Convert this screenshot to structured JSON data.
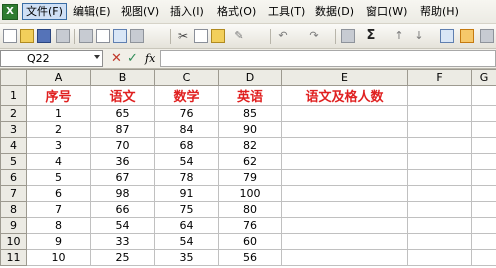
{
  "menu": {
    "items": [
      {
        "label": "文件(F)",
        "active": true
      },
      {
        "label": "编辑(E)"
      },
      {
        "label": "视图(V)"
      },
      {
        "label": "插入(I)"
      },
      {
        "label": "格式(O)"
      },
      {
        "label": "工具(T)"
      },
      {
        "label": "数据(D)"
      },
      {
        "label": "窗口(W)"
      },
      {
        "label": "帮助(H)"
      }
    ]
  },
  "toolbar": {
    "sigma": "Σ",
    "icons": [
      "new-doc-icon",
      "open-folder-icon",
      "save-icon",
      "permission-icon",
      "print-icon",
      "print-preview-icon",
      "spell-check-icon",
      "research-icon",
      "cut-icon",
      "copy-icon",
      "paste-icon",
      "format-painter-icon",
      "undo-icon",
      "redo-icon",
      "hyperlink-icon",
      "autosum-icon",
      "sort-ascending-icon",
      "sort-descending-icon",
      "chart-wizard-icon",
      "drawing-icon"
    ]
  },
  "formula_bar": {
    "name_box": "Q22",
    "fx": "fx",
    "content": ""
  },
  "sheet": {
    "columns": [
      "A",
      "B",
      "C",
      "D",
      "E",
      "F",
      "G"
    ],
    "rows": [
      {
        "num": "1",
        "cells": [
          "序号",
          "语文",
          "数学",
          "英语",
          "语文及格人数",
          "",
          ""
        ],
        "header": true
      },
      {
        "num": "2",
        "cells": [
          "1",
          "65",
          "76",
          "85",
          "",
          "",
          ""
        ]
      },
      {
        "num": "3",
        "cells": [
          "2",
          "87",
          "84",
          "90",
          "",
          "",
          ""
        ]
      },
      {
        "num": "4",
        "cells": [
          "3",
          "70",
          "68",
          "82",
          "",
          "",
          ""
        ]
      },
      {
        "num": "5",
        "cells": [
          "4",
          "36",
          "54",
          "62",
          "",
          "",
          ""
        ]
      },
      {
        "num": "6",
        "cells": [
          "5",
          "67",
          "78",
          "79",
          "",
          "",
          ""
        ]
      },
      {
        "num": "7",
        "cells": [
          "6",
          "98",
          "91",
          "100",
          "",
          "",
          ""
        ]
      },
      {
        "num": "8",
        "cells": [
          "7",
          "66",
          "75",
          "80",
          "",
          "",
          ""
        ]
      },
      {
        "num": "9",
        "cells": [
          "8",
          "54",
          "64",
          "76",
          "",
          "",
          ""
        ]
      },
      {
        "num": "10",
        "cells": [
          "9",
          "33",
          "54",
          "60",
          "",
          "",
          ""
        ]
      },
      {
        "num": "11",
        "cells": [
          "10",
          "25",
          "35",
          "56",
          "",
          "",
          ""
        ]
      }
    ]
  },
  "colors": {
    "header_text": "#e02020",
    "grid_line": "#c0c0c0",
    "header_bg": "#ecebe4",
    "menu_active_bg": "#cfe0f5"
  }
}
